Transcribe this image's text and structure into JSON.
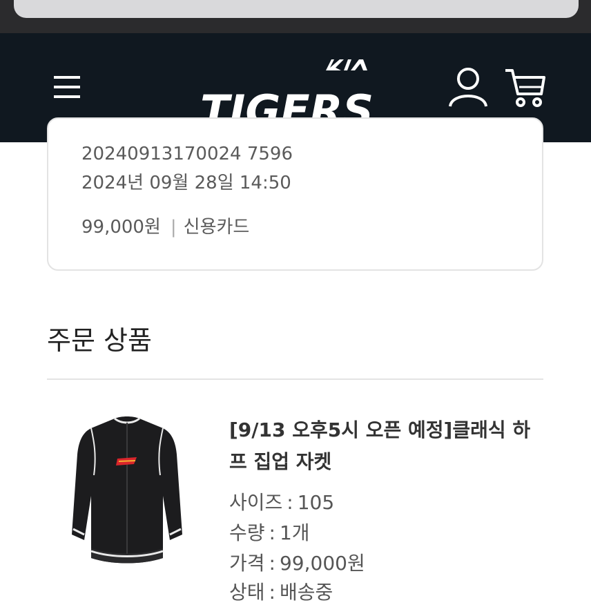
{
  "header": {
    "logo_text": "TIGERS",
    "logo_brand": "KIA"
  },
  "order": {
    "order_number": "20240913170024 7596",
    "order_date": "2024년 09월 28일 14:50",
    "amount": "99,000원",
    "separator": "|",
    "payment_method": "신용카드"
  },
  "section": {
    "title": "주문 상품"
  },
  "product": {
    "name": "[9/13 오후5시 오픈 예정]클래식 하프 집업 자켓",
    "specs": [
      {
        "label": "사이즈",
        "value": "105"
      },
      {
        "label": "수량",
        "value": "1개"
      },
      {
        "label": "가격",
        "value": "99,000원"
      },
      {
        "label": "상태",
        "value": "배송중"
      }
    ]
  },
  "colors": {
    "header_bg": "#101820",
    "browser_bar": "#2b2b2d",
    "accent_red": "#d9252b"
  }
}
